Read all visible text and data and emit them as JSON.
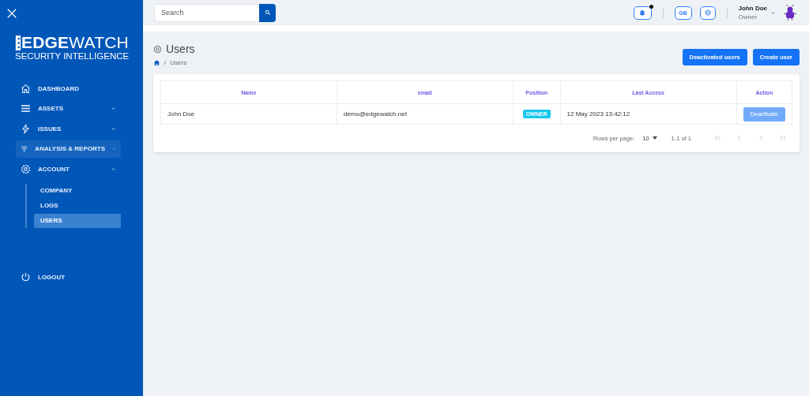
{
  "sidebar": {
    "logo": {
      "primary": "EDGE",
      "secondary": "WATCH",
      "tagline": "SECURITY INTELLIGENCE"
    },
    "items": [
      {
        "label": "DASHBOARD",
        "selected": false,
        "hovered": false
      },
      {
        "label": "ASSETS",
        "selected": false,
        "hovered": false,
        "expanded": false
      },
      {
        "label": "ISSUES",
        "selected": false,
        "hovered": false,
        "expanded": false
      },
      {
        "label": "ANALYSIS & REPORTS",
        "selected": false,
        "hovered": true,
        "expanded": false
      },
      {
        "label": "ACCOUNT",
        "selected": false,
        "hovered": false,
        "expanded": true,
        "children": [
          {
            "label": "COMPANY",
            "selected": false
          },
          {
            "label": "LOGS",
            "selected": false
          },
          {
            "label": "USERS",
            "selected": true
          }
        ]
      }
    ],
    "logout": "LOGOUT"
  },
  "topbar": {
    "search": {
      "placeholder": "Search"
    },
    "notifications": {
      "unread": true
    },
    "language": "GB",
    "user": {
      "name": "John Doe",
      "role": "Owner"
    }
  },
  "page": {
    "title": "Users",
    "breadcrumb_separator": "/",
    "breadcrumb": [
      "Users"
    ],
    "actions": [
      "Deactivated users",
      "Create user"
    ]
  },
  "table": {
    "columns": [
      "Name",
      "email",
      "Position",
      "Last Access",
      "Action"
    ],
    "rows": [
      {
        "name": "John Doe",
        "email": "demo@edgewatch.net",
        "position": "OWNER",
        "last_access": "12 May 2023 13:42:12",
        "action": {
          "label": "Deactivate",
          "disabled": true
        }
      }
    ]
  },
  "pagination": {
    "rows_per_page_label": "Rows per page:",
    "rows_per_page": "10",
    "range": "1-1 of 1",
    "first_disabled": true,
    "prev_disabled": true,
    "next_disabled": true,
    "last_disabled": true
  }
}
